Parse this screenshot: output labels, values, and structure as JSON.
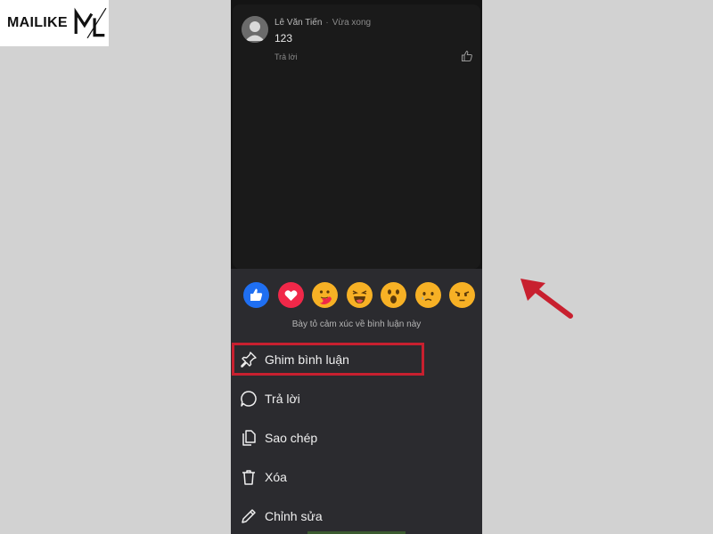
{
  "brand": {
    "text": "MAILIKE",
    "logo_mark": "ML"
  },
  "comment": {
    "author": "Lê Văn Tiến",
    "time": "Vừa xong",
    "text": "123",
    "reply_label": "Trả lời",
    "avatar_icon": "default-avatar-icon",
    "like_icon": "thumbs-up-outline-icon"
  },
  "reactions": {
    "items": [
      "like",
      "love",
      "care",
      "haha",
      "wow",
      "sad",
      "angry"
    ],
    "caption": "Bày tỏ cảm xúc về bình luận này"
  },
  "menu": {
    "items": [
      {
        "label": "Ghim bình luận",
        "icon": "pin-icon"
      },
      {
        "label": "Trả lời",
        "icon": "speech-bubble-icon"
      },
      {
        "label": "Sao chép",
        "icon": "copy-icon"
      },
      {
        "label": "Xóa",
        "icon": "trash-icon"
      },
      {
        "label": "Chỉnh sửa",
        "icon": "pencil-icon"
      }
    ]
  },
  "colors": {
    "page_background": "#d2d2d2",
    "sheet_background": "#2b2b2f",
    "highlight": "#c8202f",
    "arrow": "#c8202f"
  }
}
